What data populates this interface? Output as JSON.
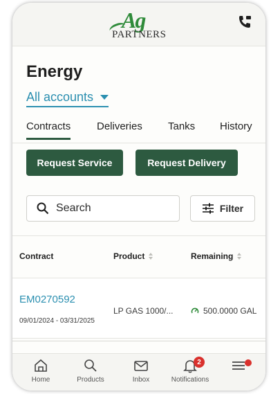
{
  "header": {
    "logo_ag": "Ag",
    "logo_partners": "PARTNERS",
    "phone_icon": "phone-icon"
  },
  "page": {
    "title": "Energy",
    "account_selector": "All accounts"
  },
  "tabs": [
    {
      "label": "Contracts",
      "active": true
    },
    {
      "label": "Deliveries",
      "active": false
    },
    {
      "label": "Tanks",
      "active": false
    },
    {
      "label": "History",
      "active": false
    }
  ],
  "actions": {
    "request_service": "Request Service",
    "request_delivery": "Request Delivery"
  },
  "search": {
    "label": "Search"
  },
  "filter": {
    "label": "Filter"
  },
  "table": {
    "columns": [
      "Contract",
      "Product",
      "Remaining"
    ],
    "rows": [
      {
        "contract": "EM0270592",
        "dates": "09/01/2024 - 03/31/2025",
        "product": "LP GAS 1000/...",
        "remaining": "500.0000 GAL"
      }
    ]
  },
  "bottom_nav": [
    {
      "label": "Home",
      "icon": "home-icon"
    },
    {
      "label": "Products",
      "icon": "search-icon"
    },
    {
      "label": "Inbox",
      "icon": "mail-icon"
    },
    {
      "label": "Notifications",
      "icon": "bell-icon",
      "badge": "2"
    },
    {
      "label": "",
      "icon": "menu-icon"
    }
  ],
  "colors": {
    "brand_green": "#2d5a40",
    "logo_green": "#2f8b3a",
    "link_blue": "#2b8fb0",
    "badge_red": "#d9302c"
  }
}
